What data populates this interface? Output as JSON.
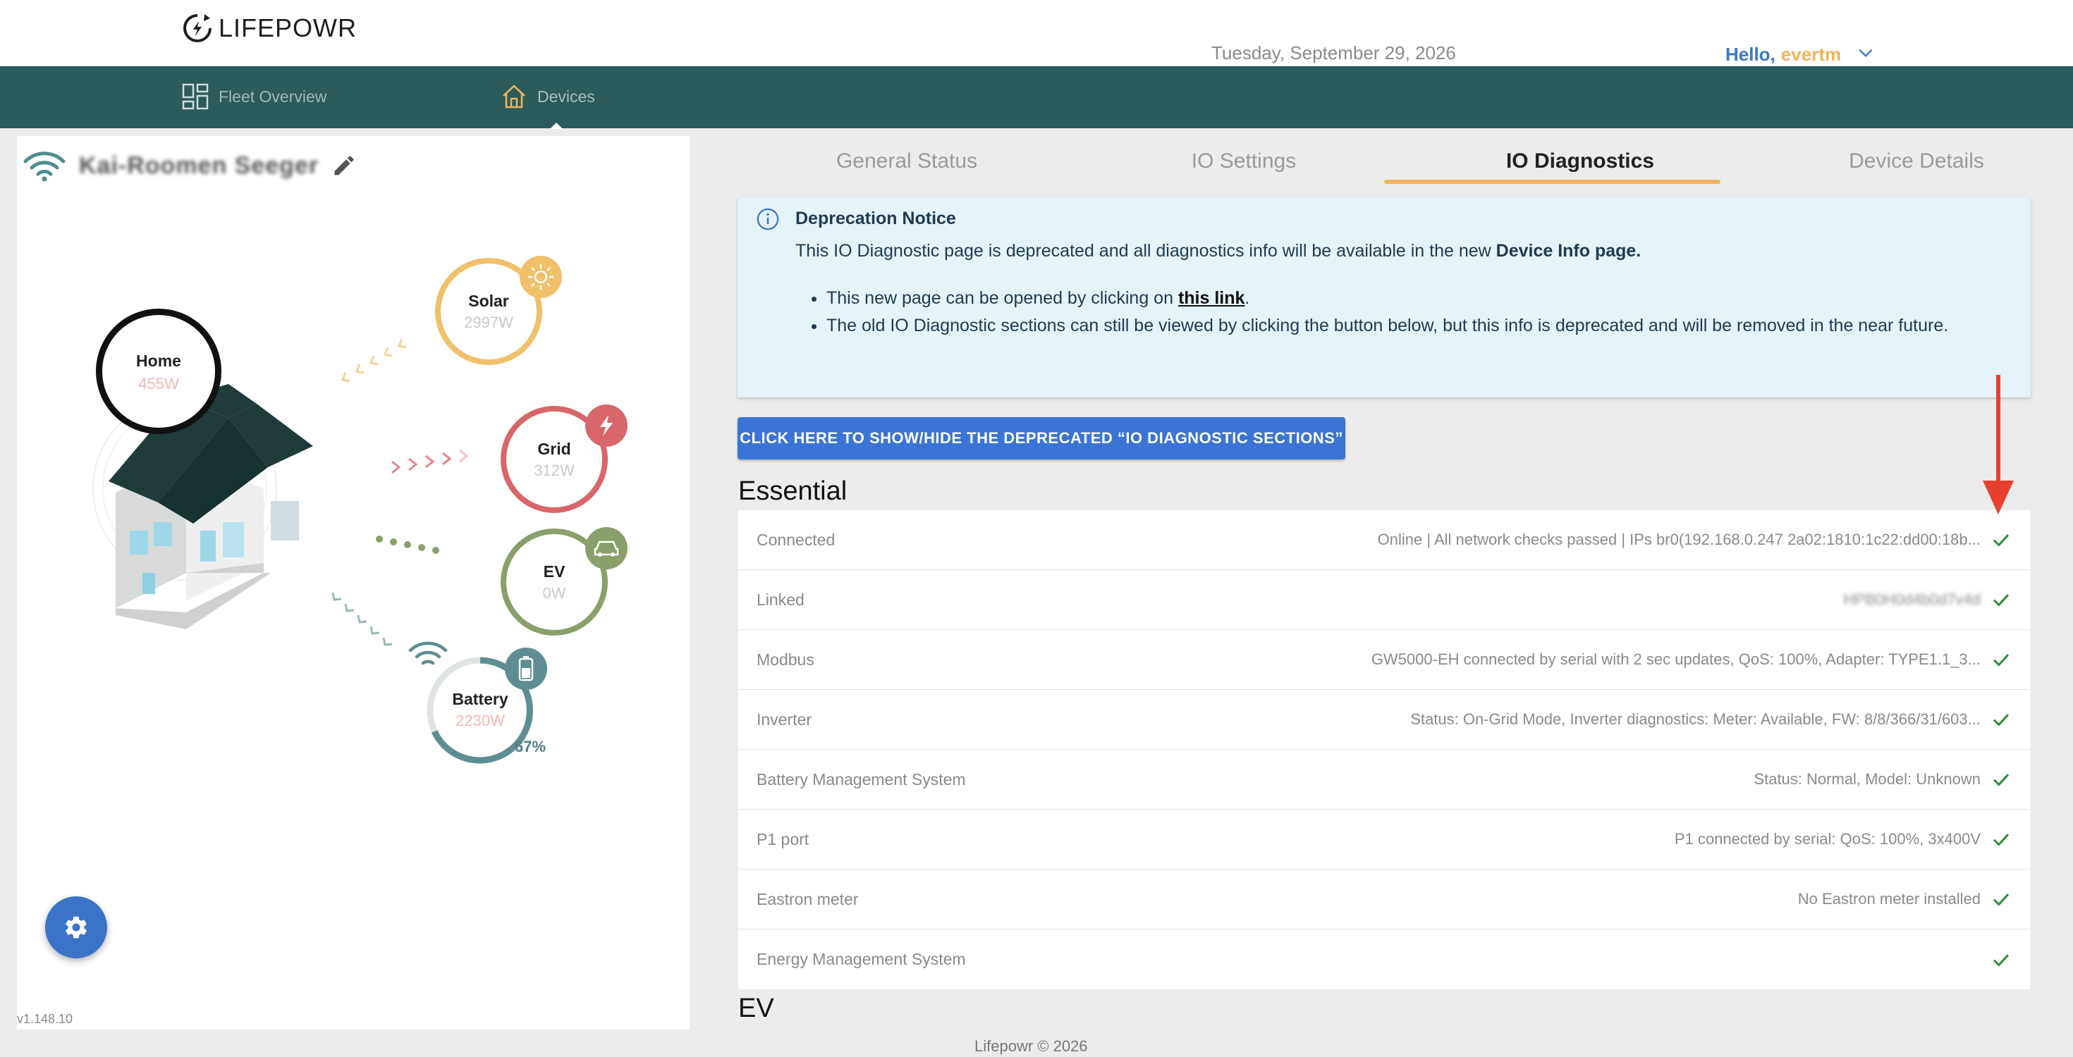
{
  "header": {
    "logo_text": "LIFEPOWR",
    "date": "Tuesday, September 29, 2026",
    "greeting": "Hello,",
    "username": "evertm"
  },
  "nav": {
    "fleet_label": "Fleet Overview",
    "devices_label": "Devices"
  },
  "device": {
    "name": "Kai-Roomen Seeger",
    "version": "v1.148.10"
  },
  "flow": {
    "home": {
      "title": "Home",
      "value": "455W"
    },
    "solar": {
      "title": "Solar",
      "value": "2997W"
    },
    "grid": {
      "title": "Grid",
      "value": "312W"
    },
    "ev": {
      "title": "EV",
      "value": "0W"
    },
    "battery": {
      "title": "Battery",
      "value": "2230W",
      "percent": "67%"
    }
  },
  "tabs": [
    {
      "label": "General Status"
    },
    {
      "label": "IO Settings"
    },
    {
      "label": "IO Diagnostics"
    },
    {
      "label": "Device Details"
    }
  ],
  "notice": {
    "title": "Deprecation Notice",
    "body_text": "This IO Diagnostic page is deprecated and all diagnostics info will be available in the new ",
    "body_bold": "Device Info page.",
    "bullet1_text": "This new page can be opened by clicking on ",
    "bullet1_link": "this link",
    "bullet1_end": ".",
    "bullet2": "The old IO Diagnostic sections can still be viewed by clicking the button below, but this info is deprecated and will be removed in the near future."
  },
  "toggle_button": "Click here to show/hide the deprecated “IO Diagnostic Sections”",
  "sections": {
    "essential": "Essential",
    "ev": "EV"
  },
  "diagnostics": [
    {
      "label": "Connected",
      "value": "Online | All network checks passed | IPs br0(192.168.0.247 2a02:1810:1c22:dd00:18b..."
    },
    {
      "label": "Linked",
      "value": "HPB0H0d4b0d7v4d"
    },
    {
      "label": "Modbus",
      "value": "GW5000-EH connected by serial with 2 sec updates, QoS: 100%, Adapter: TYPE1.1_3..."
    },
    {
      "label": "Inverter",
      "value": "Status: On-Grid Mode, Inverter diagnostics: Meter: Available, FW: 8/8/366/31/603..."
    },
    {
      "label": "Battery Management System",
      "value": "Status: Normal, Model: Unknown"
    },
    {
      "label": "P1 port",
      "value": "P1 connected by serial: QoS: 100%, 3x400V"
    },
    {
      "label": "Eastron meter",
      "value": "No Eastron meter installed"
    },
    {
      "label": "Energy Management System",
      "value": ""
    }
  ],
  "footer": "Lifepowr © 2026",
  "colors": {
    "nav_bg": "#2b5b5a",
    "accent_orange": "#f1b35c",
    "button_blue": "#3a74d6",
    "check_green": "#2e8b3a",
    "solar": "#f0c06a",
    "grid": "#d9666a",
    "ev": "#8aa06a",
    "battery": "#5e8e91"
  }
}
